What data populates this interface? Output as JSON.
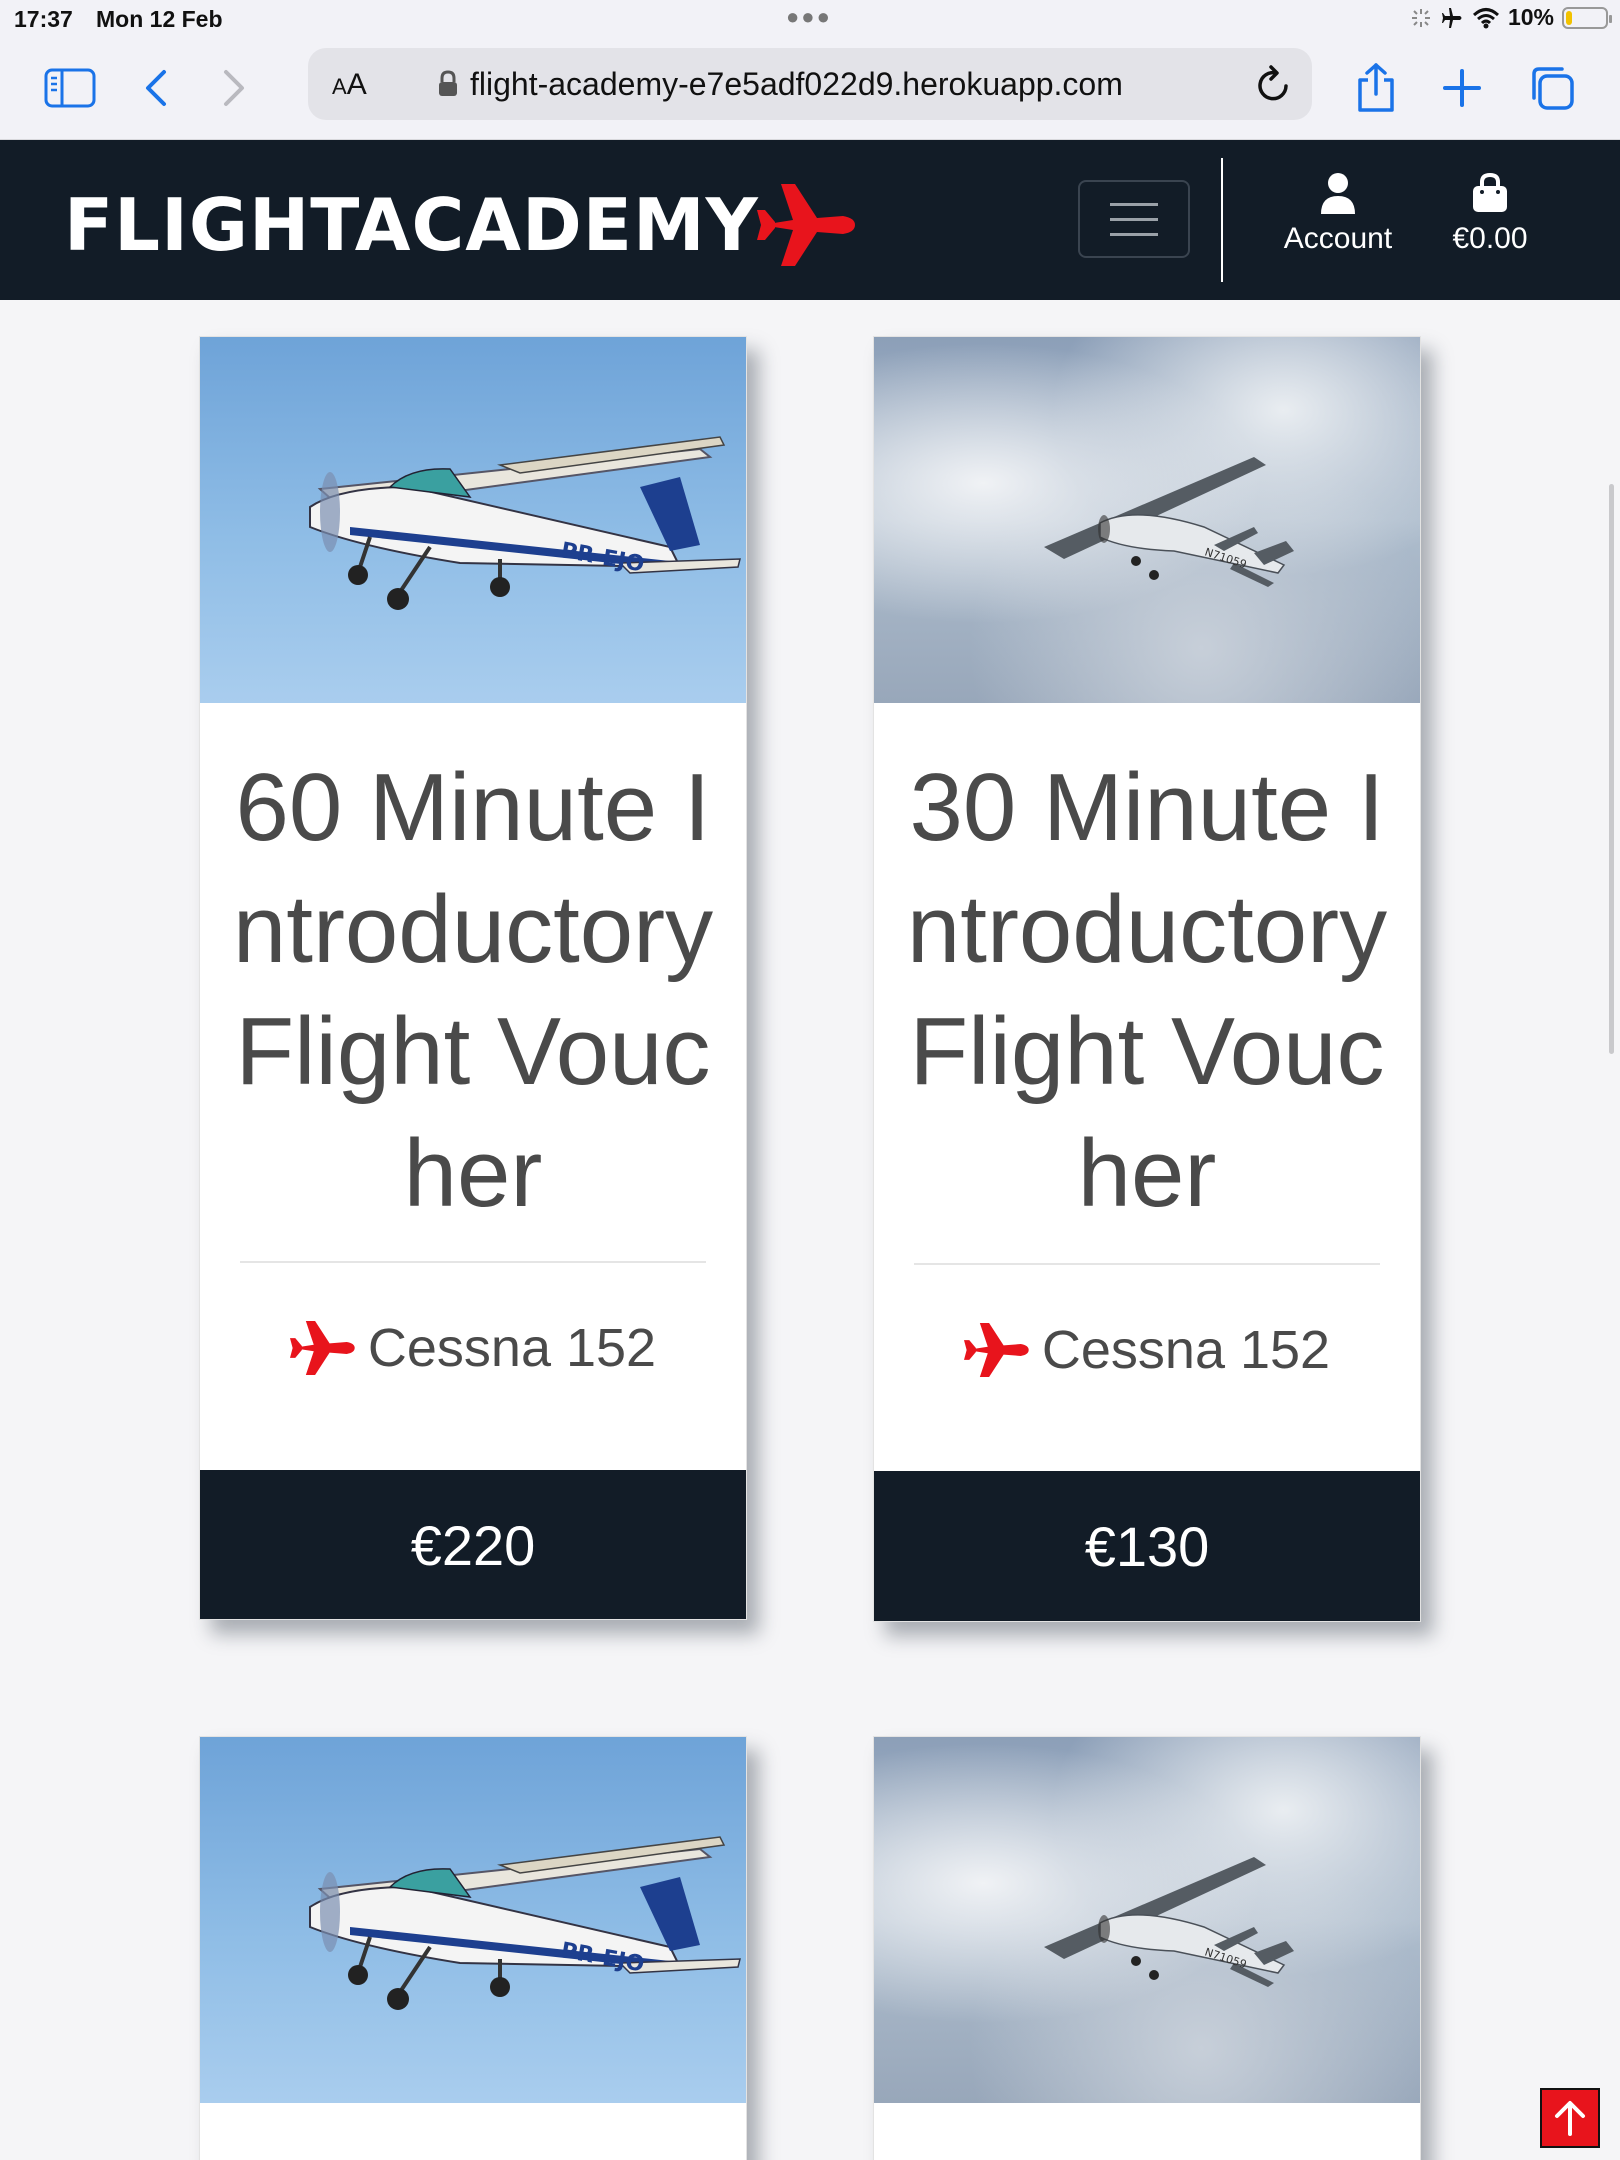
{
  "status_bar": {
    "time": "17:37",
    "date": "Mon 12 Feb",
    "battery": "10%"
  },
  "browser": {
    "aa_label": "AA",
    "url": "flight-academy-e7e5adf022d9.herokuapp.com"
  },
  "nav": {
    "logo_text": "FLIGHTACADEMY",
    "account_label": "Account",
    "bag_label": "€0.00"
  },
  "products": [
    {
      "title": "60 Minute Introductory Flight Voucher",
      "aircraft": "Cessna 152",
      "price": "€220",
      "image": "blue-sky-cessna"
    },
    {
      "title": "30 Minute Introductory Flight Voucher",
      "aircraft": "Cessna 152",
      "price": "€130",
      "image": "cloudy-sky-cessna"
    },
    {
      "title": "",
      "aircraft": "",
      "price": "",
      "image": "blue-sky-cessna"
    },
    {
      "title": "",
      "aircraft": "",
      "price": "",
      "image": "cloudy-sky-cessna"
    }
  ],
  "colors": {
    "navy": "#121c27",
    "accent_red": "#e8141c",
    "text_grey": "#4a4a4a"
  },
  "icons": [
    "sidebar-icon",
    "back-icon",
    "forward-icon",
    "lock-icon",
    "reload-icon",
    "share-icon",
    "new-tab-icon",
    "tabs-icon",
    "plane-icon",
    "account-icon",
    "bag-icon",
    "arrow-up-icon"
  ]
}
